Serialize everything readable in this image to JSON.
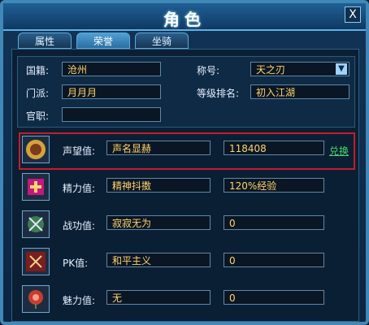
{
  "window": {
    "title": "角色",
    "close_label": "X"
  },
  "tabs": [
    {
      "label": "属性"
    },
    {
      "label": "荣誉"
    },
    {
      "label": "坐骑"
    }
  ],
  "profile": {
    "nationality_label": "国籍:",
    "nationality_value": "沧州",
    "sect_label": "门派:",
    "sect_value": "月月月",
    "office_label": "官职:",
    "office_value": "",
    "title_label": "称号:",
    "title_value": "天之刃",
    "rank_label": "等级排名:",
    "rank_value": "初入江湖"
  },
  "honor_rows": [
    {
      "label": "声望值:",
      "status": "声名显赫",
      "value": "118408",
      "action": "兑换",
      "icon": "reputation-icon"
    },
    {
      "label": "精力值:",
      "status": "精神抖擞",
      "value": "120%经验",
      "icon": "energy-icon"
    },
    {
      "label": "战功值:",
      "status": "寂寂无为",
      "value": "0",
      "icon": "merit-icon"
    },
    {
      "label": "PK值:",
      "status": "和平主义",
      "value": "0",
      "icon": "pk-icon"
    },
    {
      "label": "魅力值:",
      "status": "无",
      "value": "0",
      "icon": "charm-icon"
    }
  ],
  "colors": {
    "accent": "#5ab2e5",
    "highlight": "#c31d2a",
    "link": "#48d36a",
    "value": "#ffd36b"
  }
}
